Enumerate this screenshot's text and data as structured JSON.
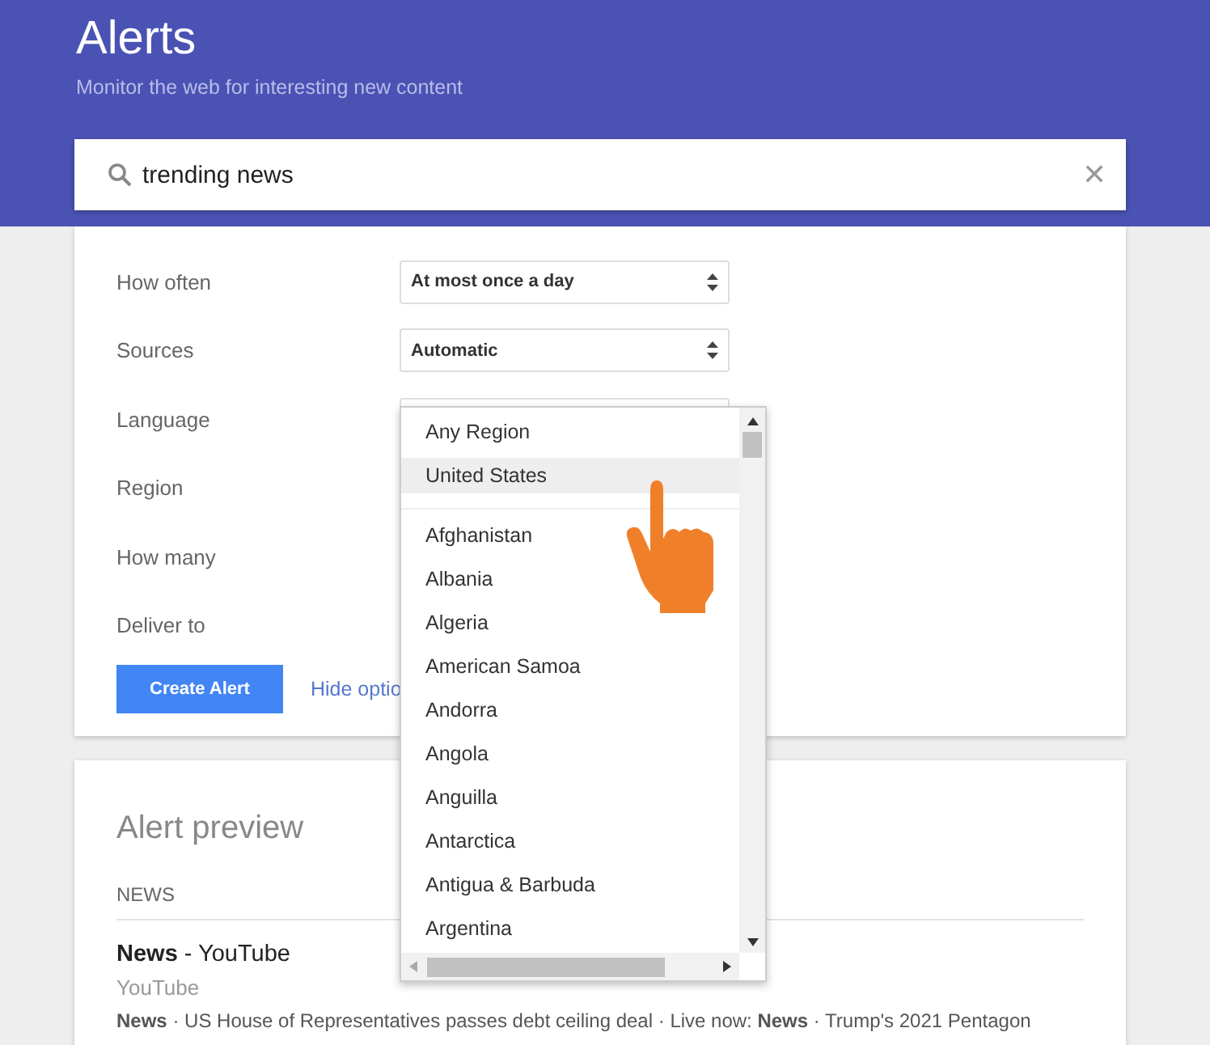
{
  "header": {
    "title": "Alerts",
    "subtitle": "Monitor the web for interesting new content"
  },
  "search": {
    "value": "trending news",
    "clear": "✕"
  },
  "options": [
    {
      "kind": "select",
      "label": "How often",
      "value": "At most once a day"
    },
    {
      "kind": "select",
      "label": "Sources",
      "value": "Automatic"
    },
    {
      "kind": "select",
      "label": "Language"
    },
    {
      "kind": "covered",
      "label": "Region"
    },
    {
      "kind": "covered",
      "label": "How many"
    },
    {
      "kind": "covered",
      "label": "Deliver to"
    }
  ],
  "create_button": "Create Alert",
  "hide_link": "Hide optio",
  "region_dropdown": {
    "items": [
      {
        "kind": "option",
        "label": "Any Region",
        "selected": false
      },
      {
        "kind": "option",
        "label": "United States",
        "selected": true
      },
      {
        "kind": "separator"
      },
      {
        "kind": "option",
        "label": "Afghanistan",
        "selected": false
      },
      {
        "kind": "option",
        "label": "Albania",
        "selected": false
      },
      {
        "kind": "option",
        "label": "Algeria",
        "selected": false
      },
      {
        "kind": "option",
        "label": "American Samoa",
        "selected": false
      },
      {
        "kind": "option",
        "label": "Andorra",
        "selected": false
      },
      {
        "kind": "option",
        "label": "Angola",
        "selected": false
      },
      {
        "kind": "option",
        "label": "Anguilla",
        "selected": false
      },
      {
        "kind": "option",
        "label": "Antarctica",
        "selected": false
      },
      {
        "kind": "option",
        "label": "Antigua & Barbuda",
        "selected": false
      },
      {
        "kind": "option",
        "label": "Argentina",
        "selected": false
      }
    ]
  },
  "preview": {
    "title": "Alert preview",
    "section": "NEWS",
    "result": {
      "title": "**News** - YouTube",
      "source": "YouTube",
      "snippet": "**News** · US House of Representatives passes debt ceiling deal · Live now: **News** · Trump's 2021 Pentagon"
    }
  }
}
